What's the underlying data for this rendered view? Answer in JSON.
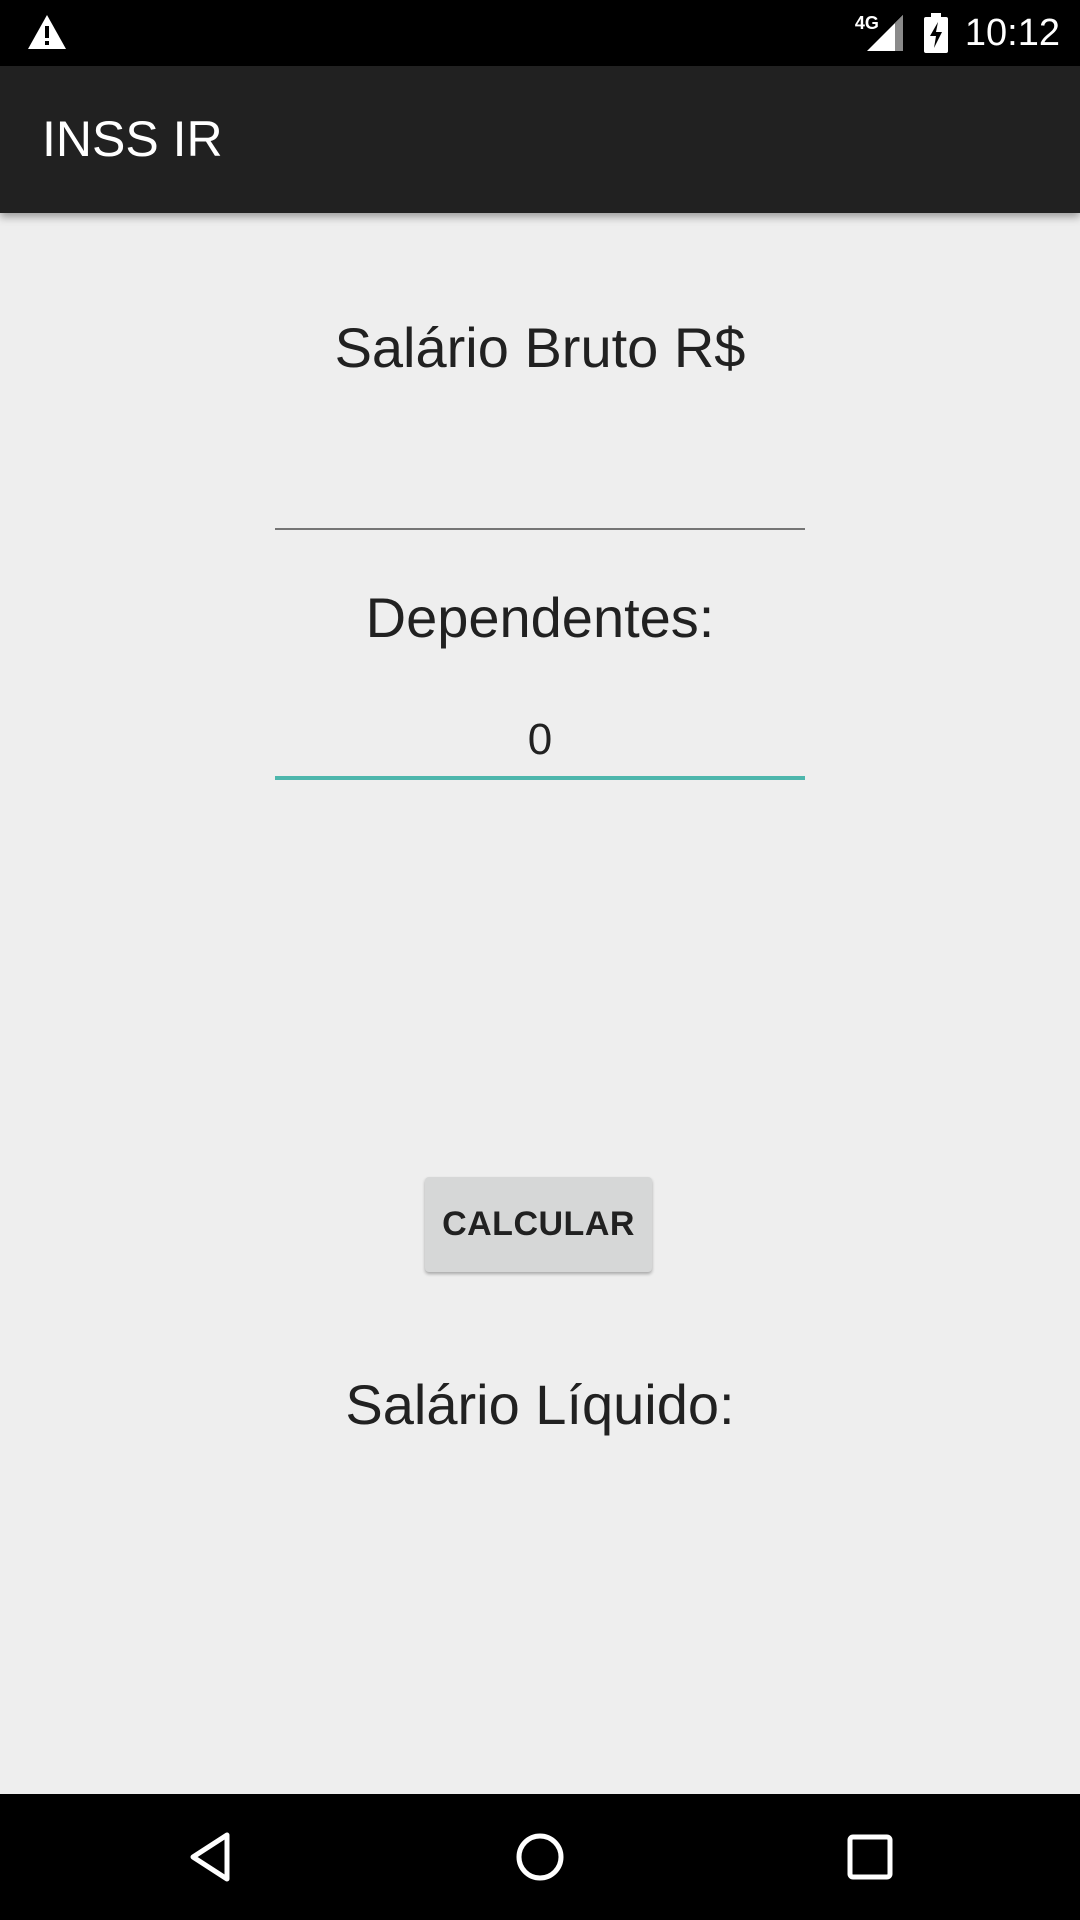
{
  "status_bar": {
    "network": "4G",
    "time": "10:12",
    "icons": [
      "warning-icon",
      "signal-icon",
      "battery-charging-icon"
    ]
  },
  "app_bar": {
    "title": "INSS IR"
  },
  "form": {
    "salario_label": "Salário Bruto R$",
    "salario_value": "",
    "dependentes_label": "Dependentes:",
    "dependentes_value": "0",
    "calculate_label": "CALCULAR",
    "result_label": "Salário Líquido:"
  },
  "nav_bar": {
    "icons": [
      "back-icon",
      "home-icon",
      "recents-icon"
    ]
  },
  "colors": {
    "status_bar": "#000000",
    "app_bar": "#212121",
    "background": "#eeeeee",
    "accent": "#4db6ac",
    "button": "#d6d7d7"
  }
}
